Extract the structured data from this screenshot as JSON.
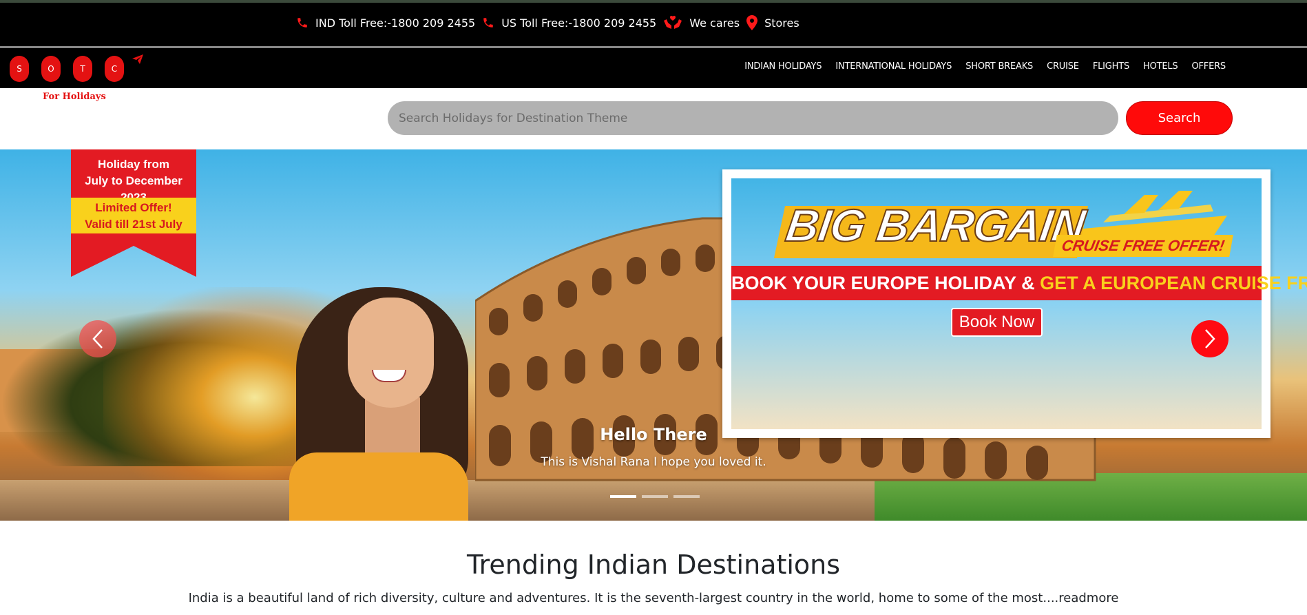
{
  "contact": {
    "ind_toll": "IND Toll Free:-1800 209 2455",
    "us_toll": "US Toll Free:-1800 209 2455",
    "we_cares": "We cares",
    "stores": "Stores"
  },
  "logo": {
    "letters": [
      "S",
      "O",
      "T",
      "C"
    ],
    "tagline": "For Holidays"
  },
  "nav": {
    "items": [
      "INDIAN HOLIDAYS",
      "INTERNATIONAL HOLIDAYS",
      "SHORT BREAKS",
      "CRUISE",
      "FLIGHTS",
      "HOTELS",
      "OFFERS"
    ]
  },
  "search": {
    "placeholder": "Search Holidays for Destination Theme",
    "value": "",
    "button_label": "Search"
  },
  "hero": {
    "ribbon": {
      "line1": "Holiday from",
      "line2": "July to December 2023",
      "line3": "Limited Offer!",
      "line4": "Valid till 21st July"
    },
    "promo": {
      "title": "BIG BARGAIN",
      "tag": "CRUISE FREE OFFER!",
      "banner_white": "BOOK YOUR EUROPE HOLIDAY & ",
      "banner_yellow": "GET A EUROPEAN CRUISE FREE!",
      "book_now": "Book Now"
    },
    "caption_title": "Hello There",
    "caption_text": "This is Vishal Rana I hope you loved it.",
    "slide_count": 3,
    "active_slide": 1
  },
  "trending": {
    "title": "Trending Indian Destinations",
    "text": "India is a beautiful land of rich diversity, culture and adventures. It is the seventh-largest country in the world, home to some of the most",
    "readmore": "....readmore"
  },
  "colors": {
    "brand_red": "#ff0a0a",
    "nav_bg": "#000000",
    "search_bg": "#b2b2b2"
  }
}
